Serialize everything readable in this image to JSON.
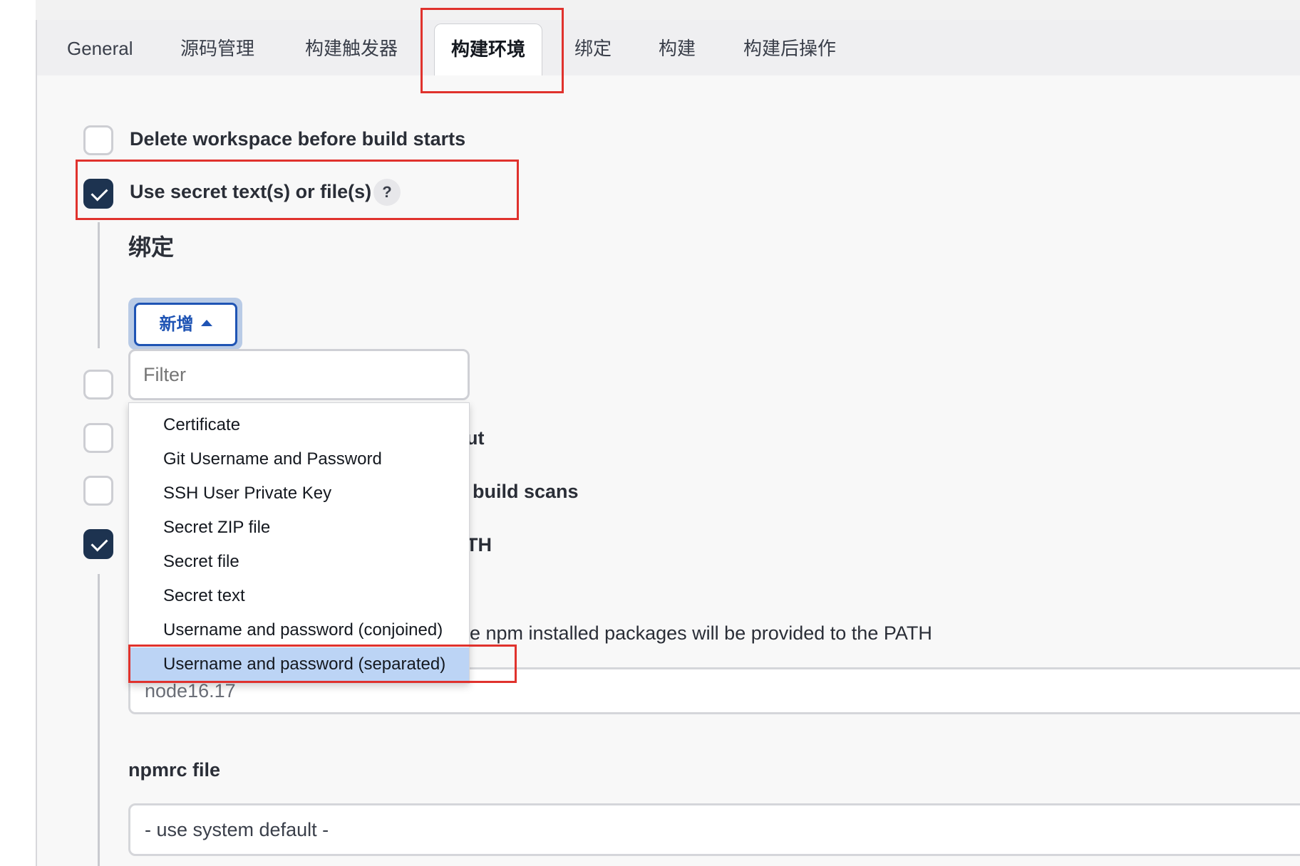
{
  "tabs": [
    {
      "label": "General"
    },
    {
      "label": "源码管理"
    },
    {
      "label": "构建触发器"
    },
    {
      "label": "构建环境"
    },
    {
      "label": "绑定"
    },
    {
      "label": "构建"
    },
    {
      "label": "构建后操作"
    }
  ],
  "active_tab": "构建环境",
  "options": {
    "delete_workspace": {
      "label": "Delete workspace before build starts",
      "checked": false
    },
    "use_secret": {
      "label": "Use secret text(s) or file(s)",
      "checked": true,
      "help": "?"
    }
  },
  "bindings": {
    "title": "绑定",
    "add_button": "新增",
    "filter_placeholder": "Filter",
    "menu_items": [
      "Certificate",
      "Git Username and Password",
      "SSH User Private Key",
      "Secret ZIP file",
      "Secret file",
      "Secret text",
      "Username and password (conjoined)",
      "Username and password (separated)"
    ],
    "selected_item": "Username and password (separated)"
  },
  "partially_hidden": {
    "row_a_tail": "ut",
    "row_b_tail": "build scans",
    "row_c_tail": "TH",
    "description_tail": "re npm installed packages will be provided to the PATH"
  },
  "node": {
    "installation_value": "node16.17",
    "npmrc_label": "npmrc file",
    "npmrc_value": "- use system default -"
  },
  "colors": {
    "accent": "#1f54b4",
    "checkbox_checked": "#1d3350",
    "highlight": "#e0322d",
    "selected_row": "#bcd4f5"
  }
}
